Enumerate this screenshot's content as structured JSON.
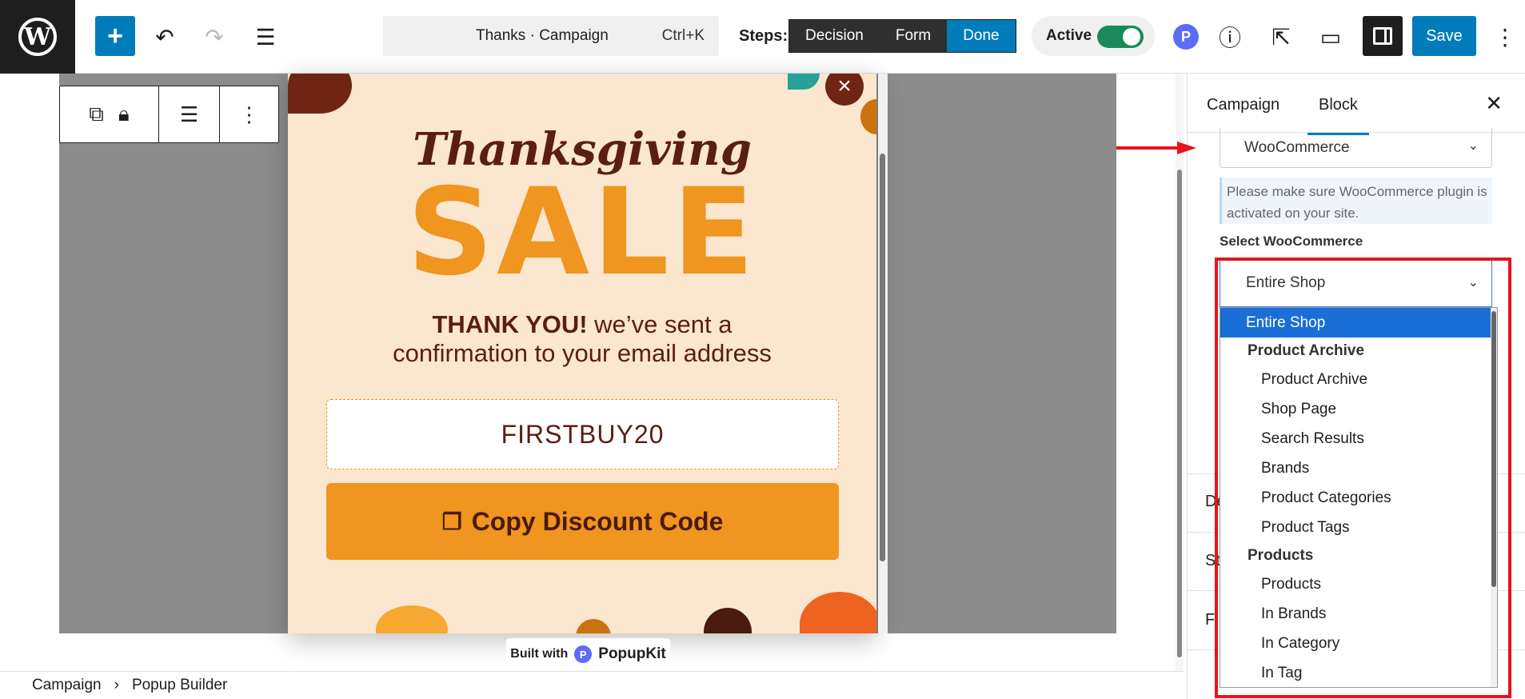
{
  "topbar": {
    "wp_logo": "W",
    "add_label": "+",
    "command": {
      "title": "Thanks · Campaign",
      "shortcut": "Ctrl+K"
    },
    "steps_label": "Steps:",
    "steps": [
      "Decision",
      "Form",
      "Done"
    ],
    "active_step": "Done",
    "active_label": "Active",
    "active_on": true,
    "popupkit_icon": "P",
    "save_label": "Save"
  },
  "popup": {
    "title": "Thanksgiving",
    "headline": "SALE",
    "thank_bold": "THANK YOU!",
    "thank_rest": " we’ve sent a",
    "thank_line2": "confirmation to your email address",
    "code": "FIRSTBUY20",
    "copy_label": "Copy Discount Code",
    "built_with": "Built with",
    "brand": "PopupKit"
  },
  "breadcrumb": [
    "Campaign",
    "Popup Builder"
  ],
  "sidebar": {
    "tabs": [
      "Campaign",
      "Block"
    ],
    "active_tab": "Block",
    "source_select": "WooCommerce",
    "notice": "Please make sure WooCommerce plugin is activated on your site.",
    "select_label": "Select WooCommerce",
    "selected": "Entire Shop",
    "behind_rows": [
      "De",
      "St",
      "Fi"
    ],
    "dropdown": [
      {
        "label": "Entire Shop",
        "type": "item",
        "level": 1,
        "selected": true
      },
      {
        "label": "Product Archive",
        "type": "group"
      },
      {
        "label": "Product Archive",
        "type": "item",
        "level": 2
      },
      {
        "label": "Shop Page",
        "type": "item",
        "level": 2
      },
      {
        "label": "Search Results",
        "type": "item",
        "level": 2
      },
      {
        "label": "Brands",
        "type": "item",
        "level": 2
      },
      {
        "label": "Product Categories",
        "type": "item",
        "level": 2
      },
      {
        "label": "Product Tags",
        "type": "item",
        "level": 2
      },
      {
        "label": "Products",
        "type": "group"
      },
      {
        "label": "Products",
        "type": "item",
        "level": 2
      },
      {
        "label": "In Brands",
        "type": "item",
        "level": 2
      },
      {
        "label": "In Category",
        "type": "item",
        "level": 2
      },
      {
        "label": "In Tag",
        "type": "item",
        "level": 2
      }
    ]
  },
  "colors": {
    "accent": "#007cba",
    "popup_bg": "#fbe6cf",
    "sale_orange": "#ef9520",
    "brown": "#5a1e12",
    "highlight": "#e8131c",
    "toggle_on": "#1b8a5a"
  }
}
